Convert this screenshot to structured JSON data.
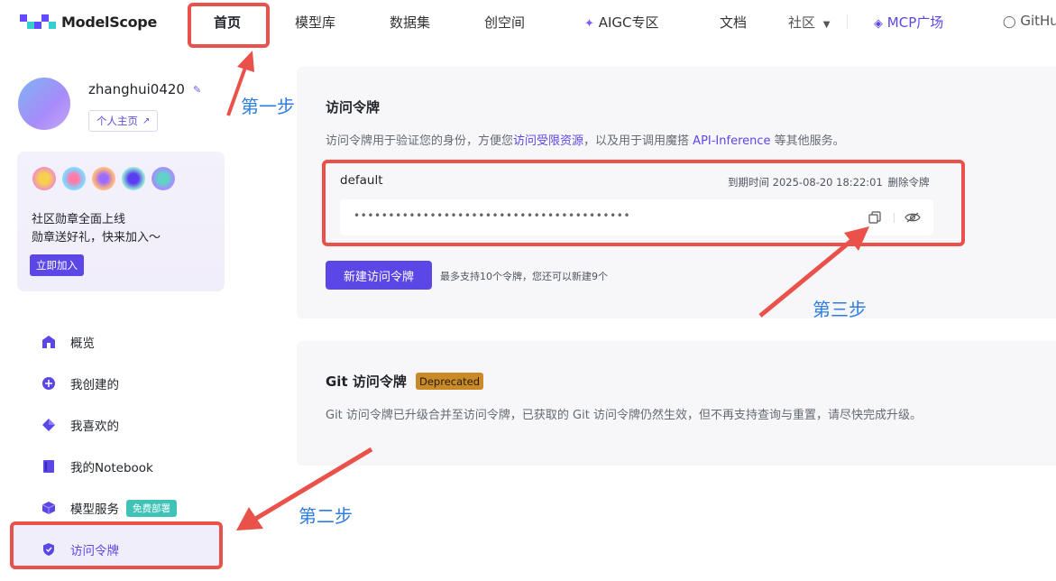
{
  "nav": {
    "logo_text": "ModelScope",
    "items": [
      "首页",
      "模型库",
      "数据集",
      "创空间",
      "AIGC专区",
      "文档",
      "社区",
      "MCP广场",
      "GitHub"
    ],
    "colors": {
      "brand": "#5b47e6",
      "mcp": "#5b47e6"
    }
  },
  "profile": {
    "username": "zhanghui0420",
    "homepage_label": "个人主页"
  },
  "badge_card": {
    "line1": "社区勋章全面上线",
    "line2": "勋章送好礼，快来加入～",
    "join_label": "立即加入"
  },
  "sidebar": {
    "items": [
      {
        "label": "概览",
        "icon": "home-icon"
      },
      {
        "label": "我创建的",
        "icon": "plus-circle-icon"
      },
      {
        "label": "我喜欢的",
        "icon": "diamond-icon"
      },
      {
        "label": "我的Notebook",
        "icon": "notebook-icon"
      },
      {
        "label": "模型服务",
        "icon": "cube-icon",
        "tag": "免费部署"
      },
      {
        "label": "访问令牌",
        "icon": "shield-icon"
      }
    ]
  },
  "token_section": {
    "title": "访问令牌",
    "desc_prefix": "访问令牌用于验证您的身份，方便您",
    "desc_link1": "访问受限资源",
    "desc_mid": "，以及用于调用魔搭 ",
    "desc_link2": "API-Inference",
    "desc_suffix": " 等其他服务。",
    "token": {
      "name": "default",
      "expire_label": "到期时间",
      "expire_value": "2025-08-20 18:22:01",
      "delete_label": "删除令牌",
      "masked_value": "••••••••••••••••••••••••••••••••••••••••"
    },
    "new_button_label": "新建访问令牌",
    "limit_hint": "最多支持10个令牌，您还可以新建9个"
  },
  "git_section": {
    "title": "Git 访问令牌",
    "tag": "Deprecated",
    "desc": "Git 访问令牌已升级合并至访问令牌，已获取的 Git 访问令牌仍然生效，但不再支持查询与重置，请尽快完成升级。"
  },
  "annotations": {
    "step1": "第一步",
    "step2": "第二步",
    "step3": "第三步",
    "color": "#e9514a",
    "label_color": "#2f7de1"
  }
}
